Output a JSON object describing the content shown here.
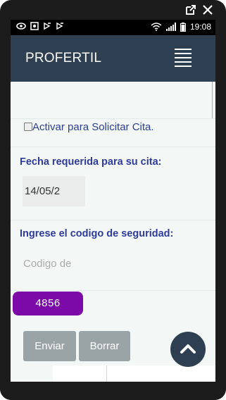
{
  "status_bar": {
    "time": "19:08",
    "left_icons": [
      "eye-icon",
      "record-icon",
      "gesture-icon",
      "gesture-icon"
    ],
    "right_icons": [
      "wifi-icon",
      "signal-icon",
      "battery-icon"
    ]
  },
  "app": {
    "title": "PROFERTIL"
  },
  "form": {
    "checkbox_label": "Activar para Solicitar Cita.",
    "date_heading": "Fecha requerida para su cita:",
    "date_value": "14/05/2",
    "code_heading": "Ingrese el codigo de seguridad:",
    "code_placeholder": "Codigo de",
    "captcha_value": "4856",
    "submit_label": "Enviar",
    "reset_label": "Borrar"
  },
  "colors": {
    "appbar": "#2e3f52",
    "heading": "#2f3b9a",
    "captcha": "#7b0aa8",
    "button": "#9aa4a6"
  }
}
